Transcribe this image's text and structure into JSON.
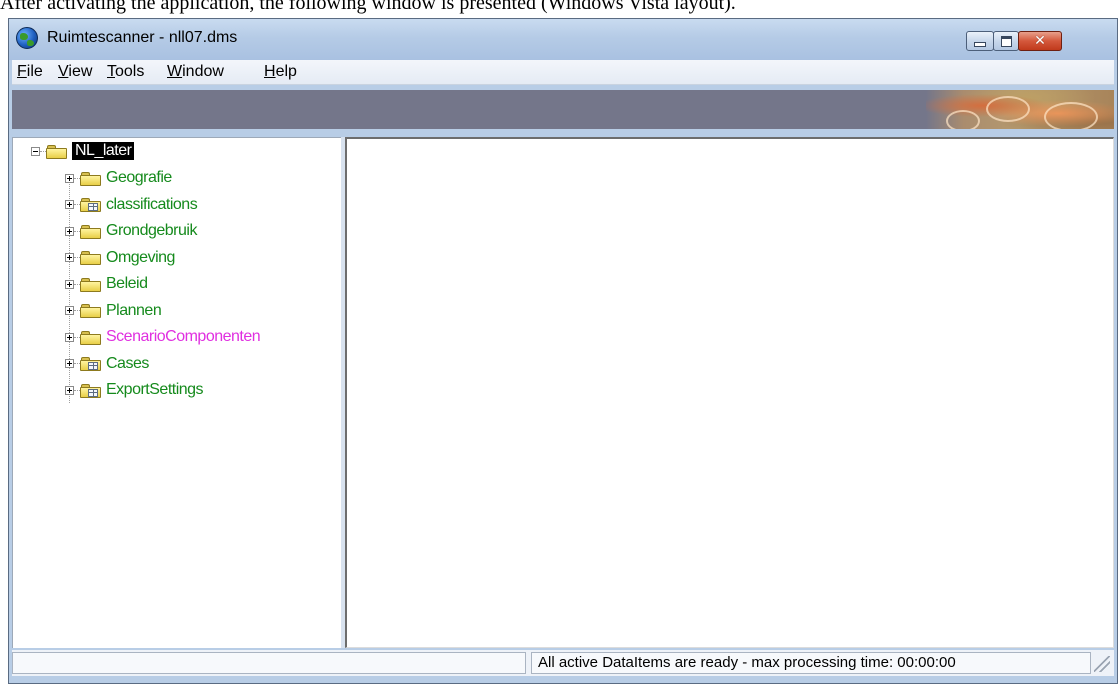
{
  "caption": "After activating the application, the following window is presented (Windows Vista layout).",
  "window": {
    "title": "Ruimtescanner - nll07.dms",
    "icon": "globe-icon",
    "controls": {
      "minimize": "minimize-icon",
      "maximize": "maximize-icon",
      "close": "close-icon"
    }
  },
  "menu": {
    "file": {
      "mnemonic": "F",
      "rest": "ile"
    },
    "view": {
      "mnemonic": "V",
      "rest": "iew"
    },
    "tools": {
      "mnemonic": "T",
      "rest": "ools"
    },
    "window": {
      "mnemonic": "W",
      "rest": "indow"
    },
    "help": {
      "mnemonic": "H",
      "rest": "elp"
    }
  },
  "tree": {
    "root": {
      "label": "NL_later",
      "expanded": true,
      "icon": "folder-icon"
    },
    "items": [
      {
        "label": "Geografie",
        "icon": "folder-icon",
        "color": "#158a1c"
      },
      {
        "label": "classifications",
        "icon": "folder-table-icon",
        "color": "#158a1c"
      },
      {
        "label": "Grondgebruik",
        "icon": "folder-icon",
        "color": "#158a1c"
      },
      {
        "label": "Omgeving",
        "icon": "folder-icon",
        "color": "#158a1c"
      },
      {
        "label": "Beleid",
        "icon": "folder-icon",
        "color": "#158a1c"
      },
      {
        "label": "Plannen",
        "icon": "folder-icon",
        "color": "#158a1c"
      },
      {
        "label": "ScenarioComponenten",
        "icon": "folder-icon",
        "color": "#e030e0"
      },
      {
        "label": "Cases",
        "icon": "folder-table-icon",
        "color": "#158a1c"
      },
      {
        "label": "ExportSettings",
        "icon": "folder-table-icon",
        "color": "#158a1c"
      }
    ]
  },
  "status": {
    "left": "",
    "right": "All active DataItems are ready - max processing time: 00:00:00"
  }
}
